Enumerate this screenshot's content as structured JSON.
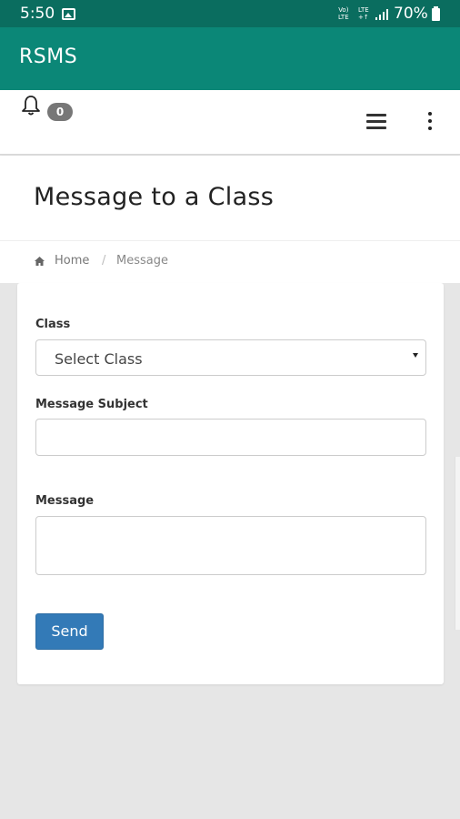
{
  "status_bar": {
    "time": "5:50",
    "volte_top": "Vo)",
    "volte_bottom": "LTE",
    "lte_top": "LTE",
    "lte_bottom": "+↑",
    "battery": "70%",
    "colors": {
      "background": "#0a6d5f"
    }
  },
  "app_bar": {
    "title": "RSMS",
    "color": "#0b8777"
  },
  "top_nav": {
    "notification_count": "0",
    "icons": [
      "bell-icon",
      "hamburger-menu-icon",
      "more-vert-icon"
    ]
  },
  "page": {
    "title": "Message to a Class"
  },
  "breadcrumb": {
    "home": "Home",
    "separator": "/",
    "current": "Message"
  },
  "form": {
    "class_label": "Class",
    "class_select_value": "Select Class",
    "subject_label": "Message Subject",
    "subject_value": "",
    "message_label": "Message",
    "message_value": "",
    "send_label": "Send",
    "send_color": "#337ab7"
  }
}
